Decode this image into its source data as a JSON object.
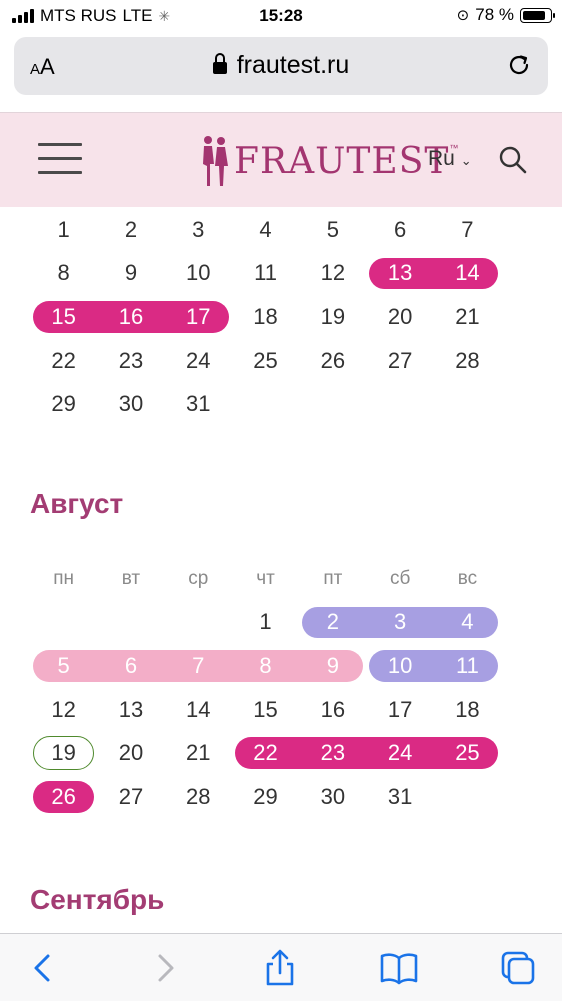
{
  "status": {
    "carrier": "MTS RUS",
    "network": "LTE",
    "time": "15:28",
    "battery": "78 %"
  },
  "browser": {
    "aa_small": "A",
    "aa_big": "A",
    "url": "frautest.ru"
  },
  "site": {
    "logo": "FRAUTEST",
    "tm": "™",
    "lang": "Ru"
  },
  "july": {
    "rows": [
      [
        "1",
        "2",
        "3",
        "4",
        "5",
        "6",
        "7"
      ],
      [
        "8",
        "9",
        "10",
        "11",
        "12",
        "13",
        "14"
      ],
      [
        "15",
        "16",
        "17",
        "18",
        "19",
        "20",
        "21"
      ],
      [
        "22",
        "23",
        "24",
        "25",
        "26",
        "27",
        "28"
      ],
      [
        "29",
        "30",
        "31",
        "",
        "",
        "",
        ""
      ]
    ]
  },
  "august": {
    "title": "Август",
    "weekdays": [
      "пн",
      "вт",
      "ср",
      "чт",
      "пт",
      "сб",
      "вс"
    ],
    "rows": [
      [
        "",
        "",
        "",
        "1",
        "2",
        "3",
        "4"
      ],
      [
        "5",
        "6",
        "7",
        "8",
        "9",
        "10",
        "11"
      ],
      [
        "12",
        "13",
        "14",
        "15",
        "16",
        "17",
        "18"
      ],
      [
        "19",
        "20",
        "21",
        "22",
        "23",
        "24",
        "25"
      ],
      [
        "26",
        "27",
        "28",
        "29",
        "30",
        "31",
        ""
      ]
    ]
  },
  "september": {
    "title": "Сентябрь"
  },
  "colors": {
    "period": "#da2a84",
    "fertile": "#a79fe2",
    "pms": "#f3aec8",
    "today_ring": "#4f8a2d",
    "header_bg": "#f7e3ea",
    "month_title": "#a33c73"
  }
}
